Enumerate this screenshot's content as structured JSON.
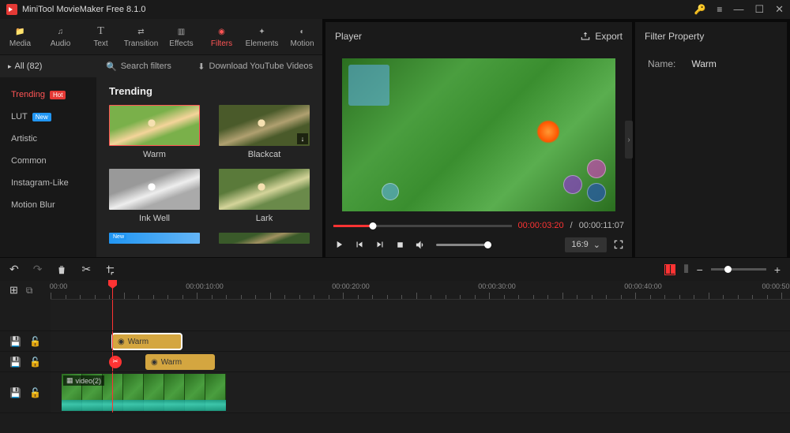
{
  "app": {
    "title": "MiniTool MovieMaker Free 8.1.0"
  },
  "toolbar": {
    "tabs": [
      {
        "label": "Media",
        "icon": "folder"
      },
      {
        "label": "Audio",
        "icon": "music"
      },
      {
        "label": "Text",
        "icon": "text"
      },
      {
        "label": "Transition",
        "icon": "transition"
      },
      {
        "label": "Effects",
        "icon": "effects"
      },
      {
        "label": "Filters",
        "icon": "filters",
        "active": true
      },
      {
        "label": "Elements",
        "icon": "elements"
      },
      {
        "label": "Motion",
        "icon": "motion"
      }
    ]
  },
  "filters": {
    "all_label": "All (82)",
    "search_placeholder": "Search filters",
    "download_label": "Download YouTube Videos",
    "categories": [
      {
        "label": "Trending",
        "badge": "Hot",
        "active": true
      },
      {
        "label": "LUT",
        "badge": "New"
      },
      {
        "label": "Artistic"
      },
      {
        "label": "Common"
      },
      {
        "label": "Instagram-Like"
      },
      {
        "label": "Motion Blur"
      }
    ],
    "grid_title": "Trending",
    "items": [
      {
        "name": "Warm",
        "active": true
      },
      {
        "name": "Blackcat",
        "downloadable": true
      },
      {
        "name": "Ink Well"
      },
      {
        "name": "Lark"
      }
    ]
  },
  "player": {
    "title": "Player",
    "export_label": "Export",
    "time_current": "00:00:03:20",
    "time_total": "00:00:11:07",
    "time_sep": " / ",
    "aspect": "16:9"
  },
  "property": {
    "title": "Filter Property",
    "name_label": "Name:",
    "name_value": "Warm"
  },
  "timeline": {
    "marks": [
      "00:00",
      "00:00:10:00",
      "00:00:20:00",
      "00:00:30:00",
      "00:00:40:00",
      "00:00:50"
    ],
    "filter_clip_label": "Warm",
    "video_clip_label": "video(2)"
  }
}
